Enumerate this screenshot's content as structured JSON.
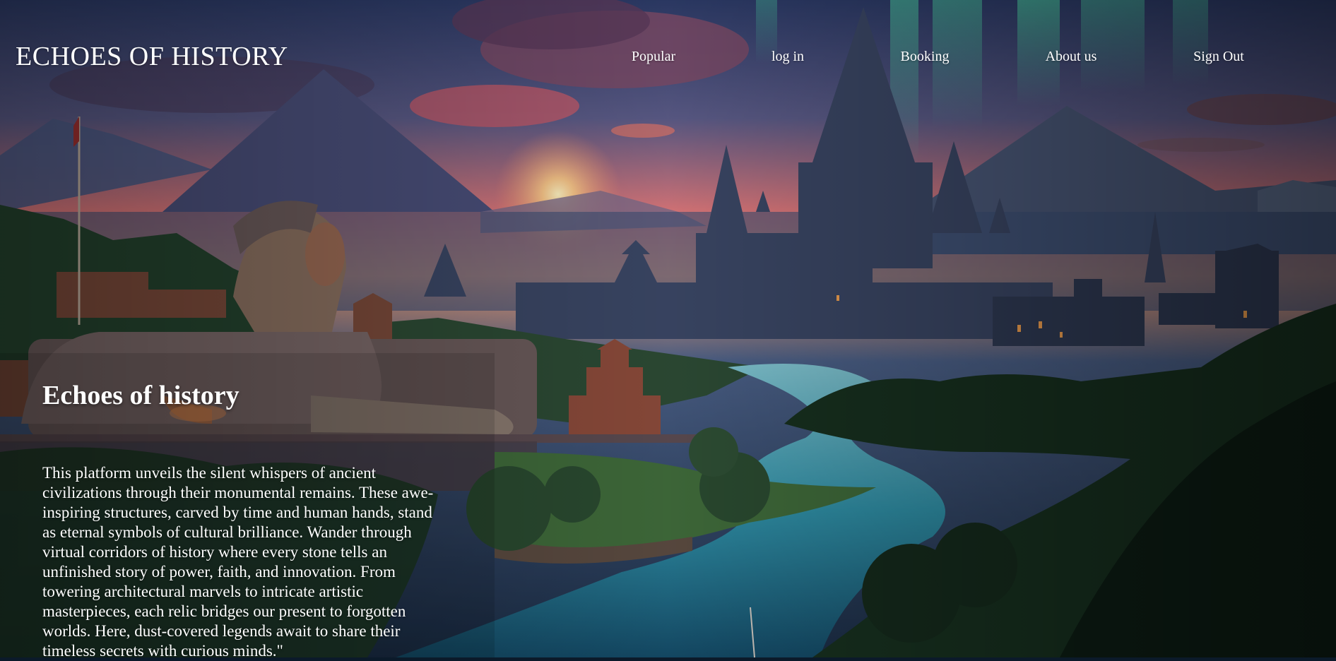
{
  "site": {
    "brand": "ECHOES OF HISTORY"
  },
  "nav": {
    "items": [
      {
        "label": "Popular"
      },
      {
        "label": "log in"
      },
      {
        "label": "Booking"
      },
      {
        "label": "About us"
      },
      {
        "label": "Sign Out"
      }
    ]
  },
  "hero": {
    "title": "Echoes of history",
    "body": "This platform unveils the silent whispers of ancient civilizations through their monumental remains. These awe-inspiring structures, carved by time and human hands, stand as eternal symbols of cultural brilliance. Wander through virtual corridors of history where every stone tells an unfinished story of power, faith, and innovation. From towering architectural marvels to intricate artistic masterpieces, each relic bridges our present to forgotten worlds. Here, dust-covered legends await to share their timeless secrets with curious minds.\""
  },
  "colors": {
    "sky_top": "#3a4a78",
    "sky_sunset": "#e07a6a",
    "aurora": "#3fd79a",
    "river": "#2f8fa6",
    "forest": "#1b3a2a",
    "stone": "#8a5a45"
  },
  "icons": {
    "background": "landscape-illustration"
  }
}
